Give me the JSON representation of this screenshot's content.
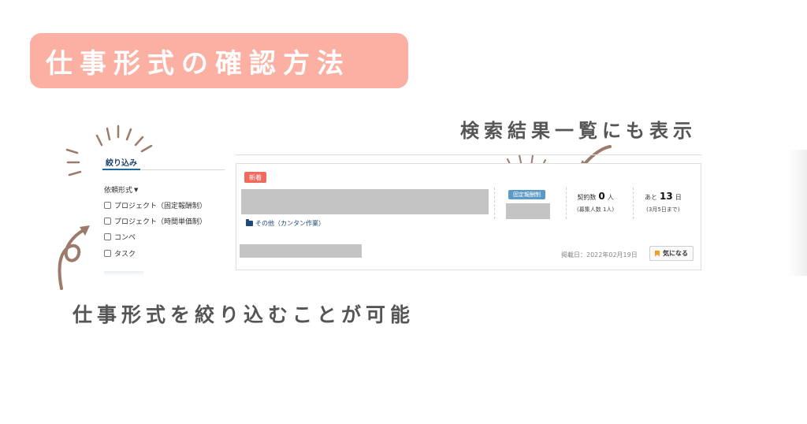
{
  "title": "仕事形式の確認方法",
  "annotations": {
    "top": "検索結果一覧にも表示",
    "bottom": "仕事形式を絞り込むことが可能"
  },
  "filter": {
    "tab_label": "絞り込み",
    "group_label": "依頼形式",
    "options": [
      "プロジェクト（固定報酬制）",
      "プロジェクト（時間単価制）",
      "コンペ",
      "タスク"
    ]
  },
  "job_card": {
    "badge_new": "新着",
    "category": "その他（カンタン作業）",
    "pay_type": "固定報酬制",
    "contracts_label": "契約数",
    "contracts_count": "0",
    "contracts_unit": "人",
    "recruit_note": "(募集人数 1人)",
    "remaining_prefix": "あと",
    "remaining_days": "13",
    "remaining_unit": "日",
    "deadline_note": "(3月5日まで)",
    "posted": "掲載日：2022年02月19日",
    "favorite_label": "気になる"
  },
  "colors": {
    "title_bg": "#fbb0a3",
    "annotation_text": "#555555",
    "accent_lines": "#9c7b6a",
    "badge_new": "#ef6b5f",
    "badge_pay": "#5b9ac4",
    "link_blue": "#1b4a7a"
  },
  "icons": [
    "folder-icon",
    "bookmark-icon",
    "checkbox-icon",
    "caret-down-icon"
  ]
}
